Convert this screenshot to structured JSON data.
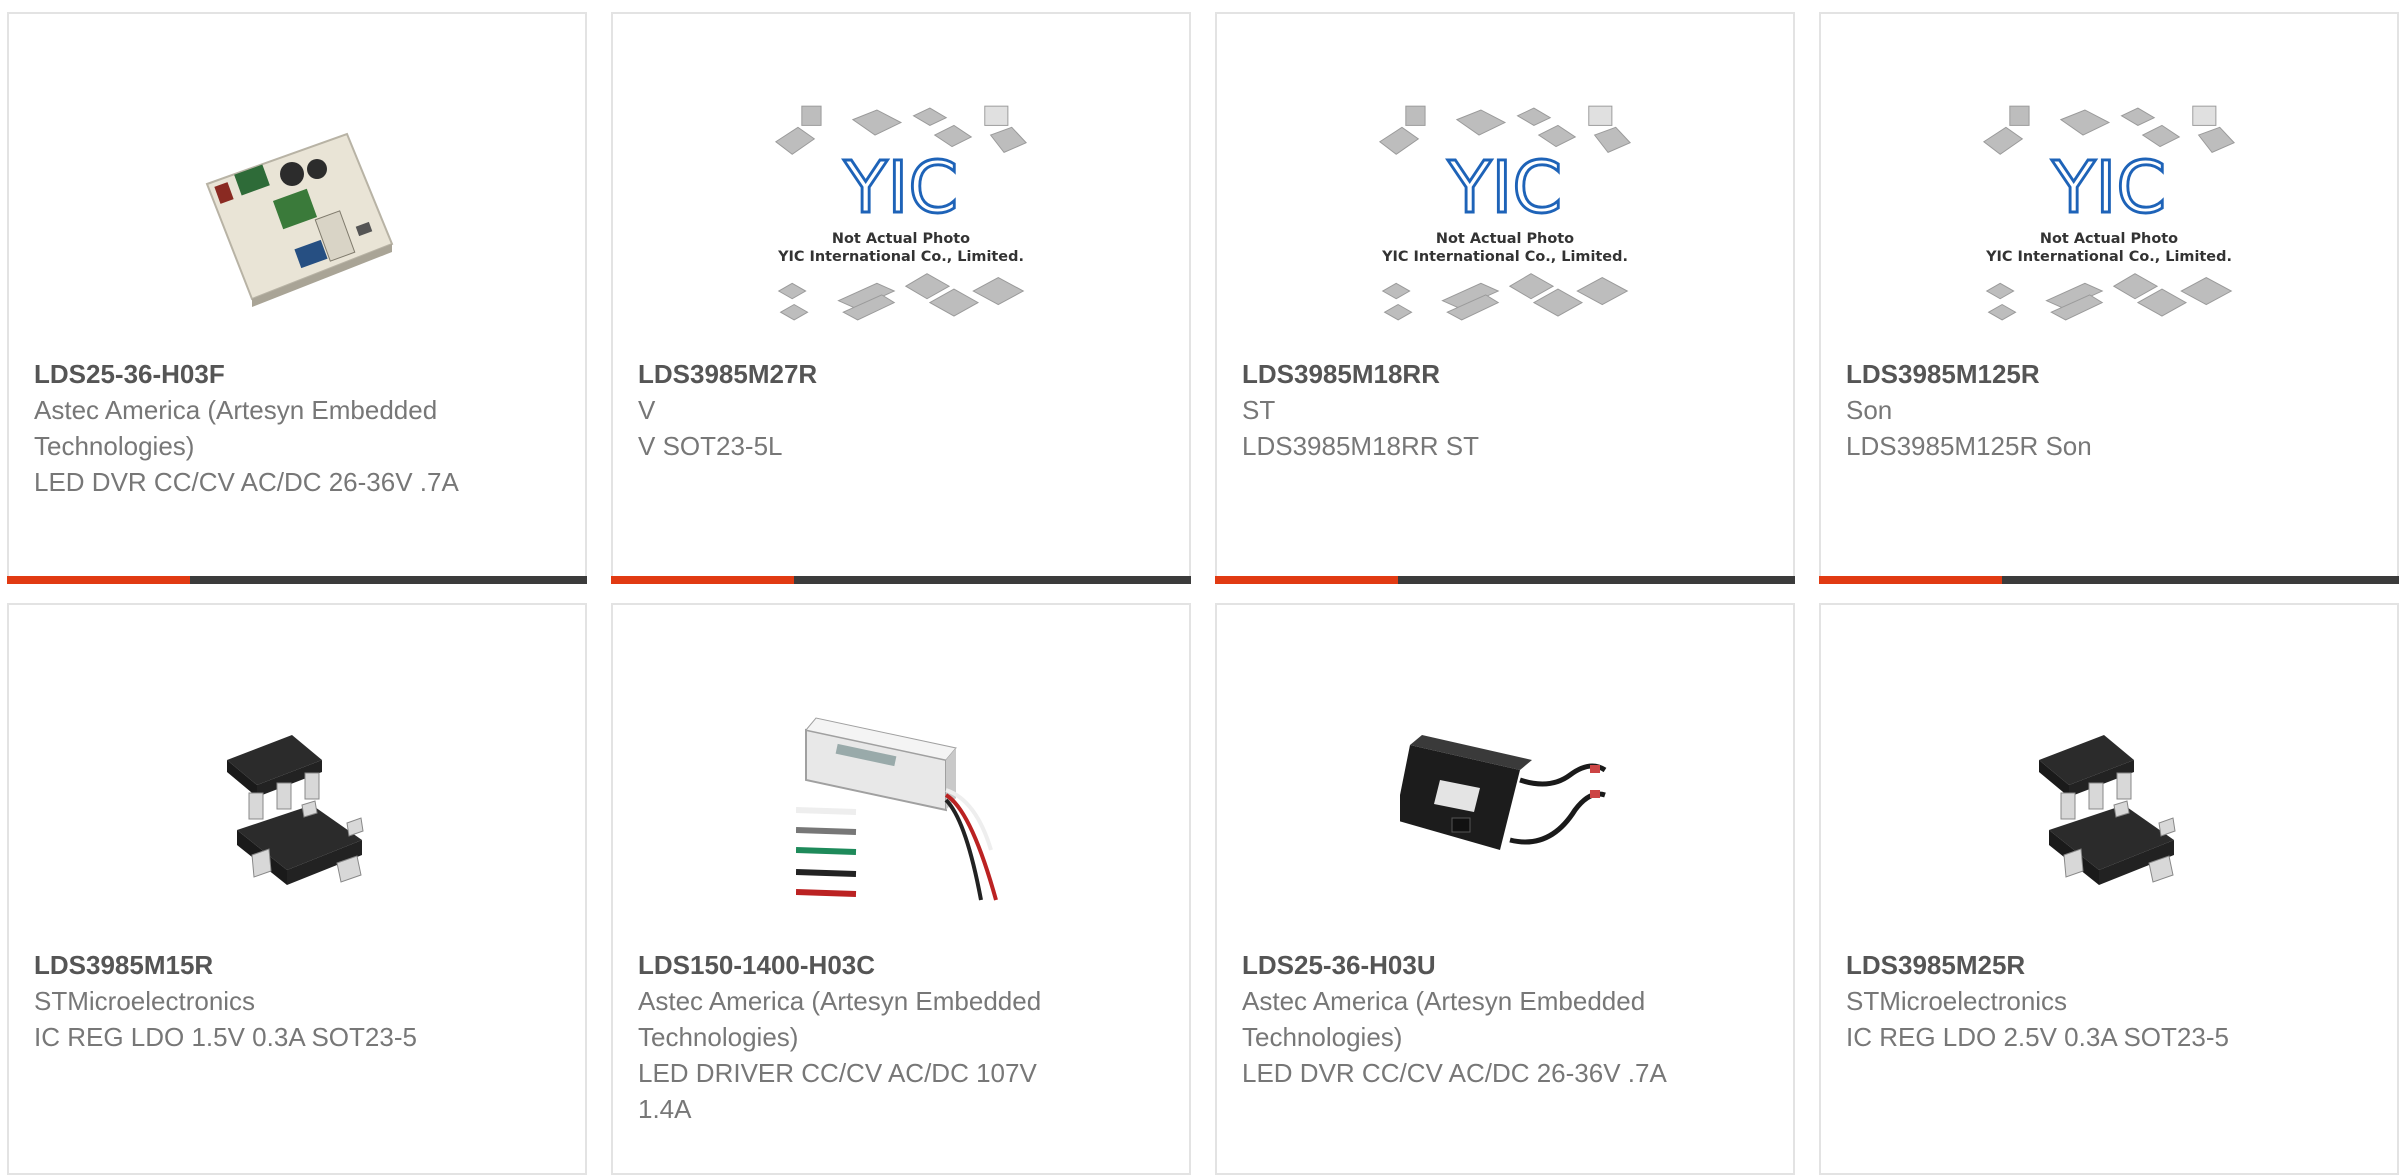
{
  "products": [
    {
      "part_number": "LDS25-36-H03F",
      "manufacturer": "Astec America (Artesyn Embedded Technologies)",
      "description": "LED DVR CC/CV AC/DC 26-36V .7A",
      "image": "led-driver-board",
      "has_bar": true
    },
    {
      "part_number": "LDS3985M27R",
      "manufacturer": "V",
      "description": "V SOT23-5L",
      "image": "placeholder",
      "has_bar": true
    },
    {
      "part_number": "LDS3985M18RR",
      "manufacturer": "ST",
      "description": "LDS3985M18RR ST",
      "image": "placeholder",
      "has_bar": true
    },
    {
      "part_number": "LDS3985M125R",
      "manufacturer": "Son",
      "description": "LDS3985M125R Son",
      "image": "placeholder",
      "has_bar": true
    },
    {
      "part_number": "LDS3985M15R",
      "manufacturer": "STMicroelectronics",
      "description": "IC REG LDO 1.5V 0.3A SOT23-5",
      "image": "sot23-5-chip",
      "has_bar": false
    },
    {
      "part_number": "LDS150-1400-H03C",
      "manufacturer": "Astec America (Artesyn Embedded Technologies)",
      "description": "LED DRIVER CC/CV AC/DC 107V 1.4A",
      "image": "led-driver-enclosure",
      "has_bar": false
    },
    {
      "part_number": "LDS25-36-H03U",
      "manufacturer": "Astec America (Artesyn Embedded Technologies)",
      "description": "LED DVR CC/CV AC/DC 26-36V .7A",
      "image": "led-driver-cable",
      "has_bar": false
    },
    {
      "part_number": "LDS3985M25R",
      "manufacturer": "STMicroelectronics",
      "description": "IC REG LDO 2.5V 0.3A SOT23-5",
      "image": "sot23-5-chip",
      "has_bar": false
    }
  ],
  "placeholder": {
    "logo_text": "YIC",
    "line1": "Not Actual Photo",
    "line2": "YIC International Co., Limited."
  },
  "colors": {
    "accent": "#e13a12",
    "bar": "#3b3b3b",
    "border": "#e3e3e3",
    "logo": "#1e63b8"
  }
}
